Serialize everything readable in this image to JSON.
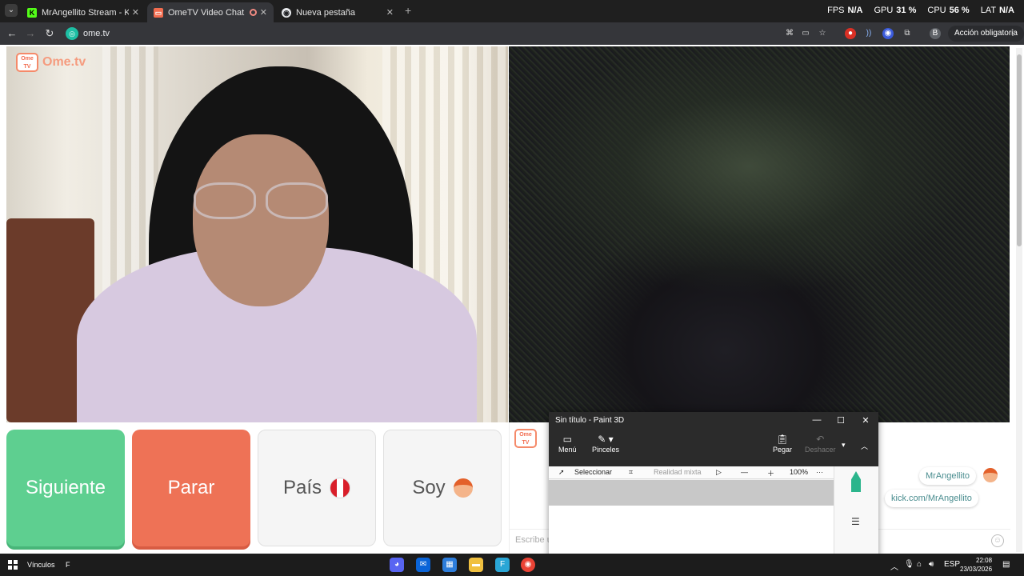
{
  "browser": {
    "tabs": [
      {
        "title": "MrAngellito Stream - Kick Dashb",
        "favicon": "kick-icon",
        "active": false
      },
      {
        "title": "OmeTV Video Chat — Ome",
        "favicon": "ometv-icon",
        "active": true
      },
      {
        "title": "Nueva pestaña",
        "favicon": "chrome-icon",
        "active": false
      }
    ],
    "new_tab": "+",
    "address": "ome.tv",
    "profile_initial": "B",
    "action_button": "Acción obligatoria"
  },
  "hud": {
    "fps_label": "FPS",
    "fps_value": "N/A",
    "gpu_label": "GPU",
    "gpu_value": "31 %",
    "cpu_label": "CPU",
    "cpu_value": "56 %",
    "lat_label": "LAT",
    "lat_value": "N/A"
  },
  "ometv": {
    "logo_badge": "Ome TV",
    "logo_text": "Ome.tv",
    "buttons": {
      "next": "Siguiente",
      "stop": "Parar",
      "country": "País",
      "i_am": "Soy"
    },
    "chat": {
      "messages": [
        "MrAngellito",
        "kick.com/MrAngellito"
      ],
      "input_placeholder": "Escribe u"
    }
  },
  "paint3d": {
    "title": "Sin título - Paint 3D",
    "ribbon": {
      "menu": "Menú",
      "brushes": "Pinceles",
      "paste": "Pegar",
      "undo": "Deshacer"
    },
    "tools": {
      "select": "Seleccionar",
      "mixed_reality": "Realidad mixta",
      "zoom": "100%",
      "more": "···"
    },
    "color": "#4940d6"
  },
  "taskbar": {
    "links_label": "Vínculos",
    "links_extra": "F",
    "language": "ESP",
    "time": "22:08",
    "date": "23/03/2026"
  },
  "colors": {
    "next_button": "#5ecf90",
    "stop_button": "#ee7256",
    "ometv_accent": "#f26c4f"
  }
}
